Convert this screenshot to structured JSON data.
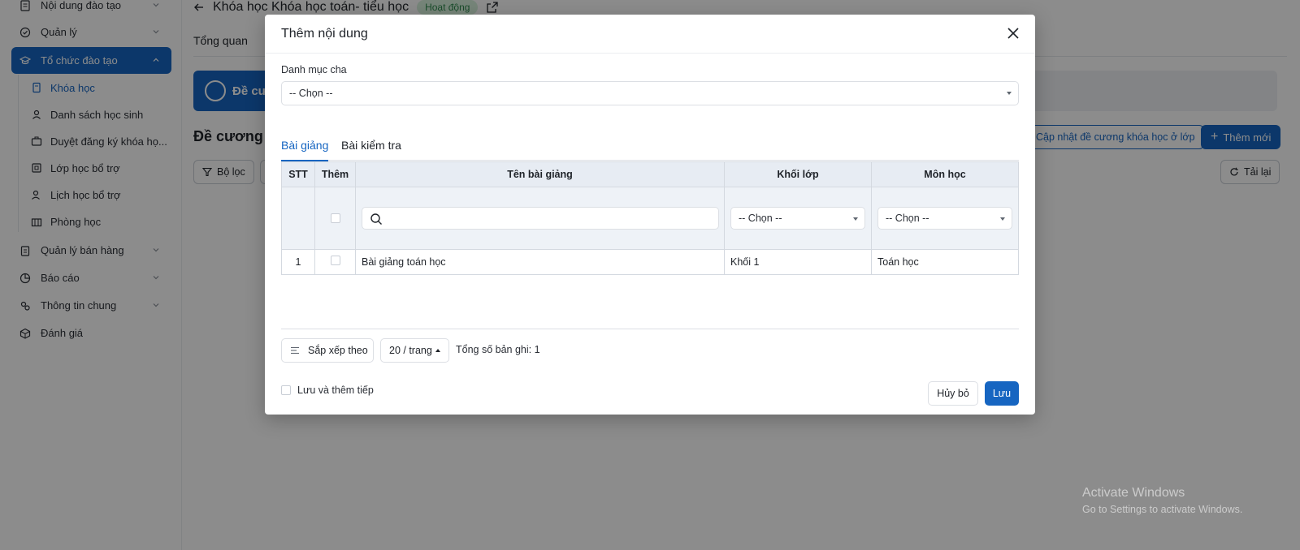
{
  "sidebar": {
    "items": [
      {
        "label": "Nội dung đào tạo",
        "icon": "book-icon"
      },
      {
        "label": "Quản lý",
        "icon": "check-circle-icon"
      },
      {
        "label": "Tổ chức đào tạo",
        "icon": "graduation-cap-icon"
      },
      {
        "label": "Quản lý bán hàng",
        "icon": "clipboard-icon"
      },
      {
        "label": "Báo cáo",
        "icon": "pie-chart-icon"
      },
      {
        "label": "Thông tin chung",
        "icon": "settings-group-icon"
      },
      {
        "label": "Đánh giá",
        "icon": "cube-icon"
      }
    ],
    "subitems": [
      {
        "label": "Khóa học",
        "icon": "course-icon"
      },
      {
        "label": "Danh sách học sinh",
        "icon": "student-icon"
      },
      {
        "label": "Duyệt đăng ký khóa họ...",
        "icon": "briefcase-icon"
      },
      {
        "label": "Lớp học bổ trợ",
        "icon": "class-icon"
      },
      {
        "label": "Lịch học bổ trợ",
        "icon": "calendar-user-icon"
      },
      {
        "label": "Phòng học",
        "icon": "building-icon"
      }
    ]
  },
  "main": {
    "breadcrumb_title": "Khóa học Khóa học toán- tiểu học",
    "status": "Hoạt động",
    "tab_overview": "Tổng quan",
    "banner_label": "Đề cư",
    "section_title": "Đề cương k",
    "filter_label": "Bộ lọc",
    "update_label": "Cập nhật đề cương khóa học ở lớp",
    "add_new_label": "Thêm mới",
    "reload_label": "Tải lại"
  },
  "modal": {
    "title": "Thêm nội dung",
    "parent_label": "Danh mục cha",
    "parent_value": "-- Chọn --",
    "tabs": [
      {
        "label": "Bài giảng",
        "active": true
      },
      {
        "label": "Bài kiểm tra",
        "active": false
      }
    ],
    "table": {
      "headers": [
        "STT",
        "Thêm",
        "Tên bài giảng",
        "Khối lớp",
        "Môn học"
      ],
      "filter_grade": "-- Chọn --",
      "filter_subject": "-- Chọn --",
      "rows": [
        {
          "stt": "1",
          "name": "Bài giảng toán học",
          "grade": "Khối 1",
          "subject": "Toán học"
        }
      ]
    },
    "sort_label": "Sắp xếp theo",
    "page_size": "20 / trang",
    "total": "Tổng số bản ghi: 1",
    "save_more_label": "Lưu và thêm tiếp",
    "cancel_label": "Hủy bỏ",
    "save_label": "Lưu"
  },
  "watermark": {
    "line1": "Activate Windows",
    "line2": "Go to Settings to activate Windows."
  },
  "colors": {
    "accent": "#1665c1",
    "status_bg": "#d7f2dd",
    "status_text": "#2e8b4d"
  }
}
